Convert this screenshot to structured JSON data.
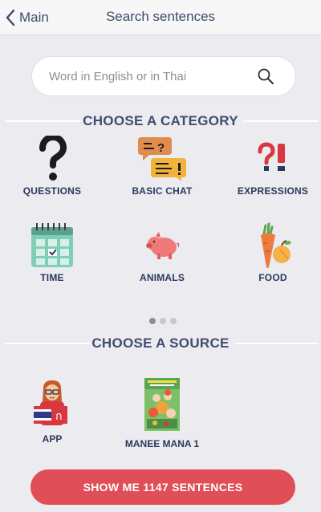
{
  "nav": {
    "back_label": "Main",
    "title": "Search sentences"
  },
  "search": {
    "placeholder": "Word in English or in Thai",
    "value": ""
  },
  "categories": {
    "heading": "CHOOSE A CATEGORY",
    "items": [
      {
        "label": "QUESTIONS",
        "icon": "question-mark-icon"
      },
      {
        "label": "BASIC CHAT",
        "icon": "chat-bubbles-icon"
      },
      {
        "label": "EXPRESSIONS",
        "icon": "exclamation-question-icon"
      },
      {
        "label": "TIME",
        "icon": "calendar-icon"
      },
      {
        "label": "ANIMALS",
        "icon": "pig-icon"
      },
      {
        "label": "FOOD",
        "icon": "carrot-apple-icon"
      }
    ],
    "pages": 3,
    "current_page": 1
  },
  "sources": {
    "heading": "CHOOSE A SOURCE",
    "items": [
      {
        "label": "APP",
        "icon": "teacher-flag-icon"
      },
      {
        "label": "MANEE MANA 1",
        "icon": "book-cover-icon"
      }
    ]
  },
  "cta": {
    "label": "SHOW ME 1147 SENTENCES"
  },
  "colors": {
    "background": "#ebebf0",
    "accent": "#e04e57",
    "text": "#2b3a5c"
  }
}
